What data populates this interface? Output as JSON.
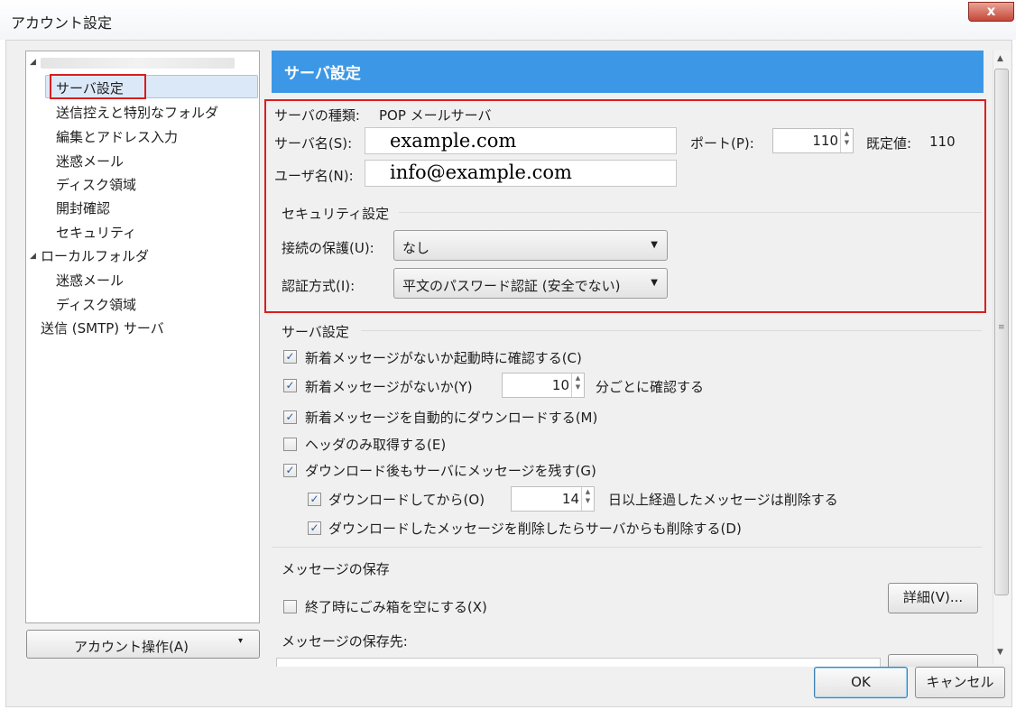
{
  "window": {
    "title": "アカウント設定",
    "close_glyph": "x"
  },
  "tree": {
    "items": [
      {
        "label": "サーバ設定"
      },
      {
        "label": "送信控えと特別なフォルダ"
      },
      {
        "label": "編集とアドレス入力"
      },
      {
        "label": "迷惑メール"
      },
      {
        "label": "ディスク領域"
      },
      {
        "label": "開封確認"
      },
      {
        "label": "セキュリティ"
      },
      {
        "label": "ローカルフォルダ"
      },
      {
        "label": "迷惑メール"
      },
      {
        "label": "ディスク領域"
      },
      {
        "label": "送信 (SMTP) サーバ"
      }
    ],
    "account_button": "アカウント操作(A)"
  },
  "panel": {
    "header": "サーバ設定",
    "server_type_label": "サーバの種類:",
    "server_type_value": "POP メールサーバ",
    "server_name_label": "サーバ名(S):",
    "server_name_value": "example.com",
    "port_label": "ポート(P):",
    "port_value": "110",
    "default_label": "既定値:",
    "default_value": "110",
    "username_label": "ユーザ名(N):",
    "username_value": "info@example.com",
    "security_title": "セキュリティ設定",
    "conn_label": "接続の保護(U):",
    "conn_value": "なし",
    "auth_label": "認証方式(I):",
    "auth_value": "平文のパスワード認証 (安全でない)",
    "server_settings_title": "サーバ設定",
    "cb1": "新着メッセージがないか起動時に確認する(C)",
    "cb2": "新着メッセージがないか(Y)",
    "cb2_value": "10",
    "cb2_suffix": "分ごとに確認する",
    "cb3": "新着メッセージを自動的にダウンロードする(M)",
    "cb4": "ヘッダのみ取得する(E)",
    "cb5": "ダウンロード後もサーバにメッセージを残す(G)",
    "cb6": "ダウンロードしてから(O)",
    "cb6_value": "14",
    "cb6_suffix": "日以上経過したメッセージは削除する",
    "cb7": "ダウンロードしたメッセージを削除したらサーバからも削除する(D)",
    "storage_title": "メッセージの保存",
    "cb8": "終了時にごみ箱を空にする(X)",
    "details_button": "詳細(V)...",
    "storage_dest_label": "メッセージの保存先:"
  },
  "footer": {
    "ok": "OK",
    "cancel": "キャンセル"
  },
  "checkbox_states": {
    "cb1": true,
    "cb2": true,
    "cb3": true,
    "cb4": false,
    "cb5": true,
    "cb6": true,
    "cb7": true,
    "cb8": false
  },
  "colors": {
    "header_blue": "#3c98e6",
    "highlight_red": "#d91e1e",
    "selection": "#dbe8f7"
  }
}
